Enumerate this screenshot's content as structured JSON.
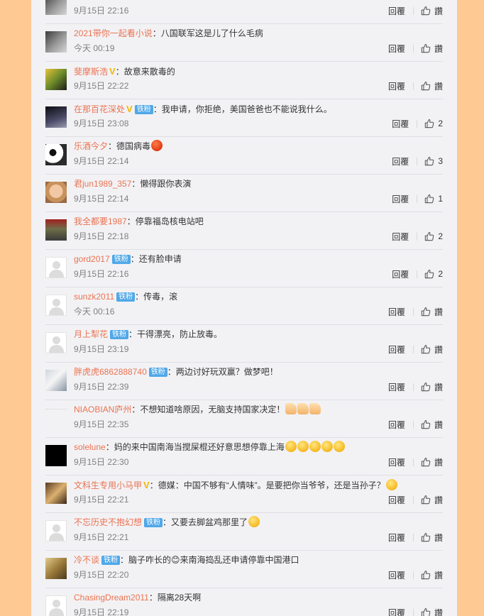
{
  "comments": [
    {
      "avatar": "av-a",
      "name": "",
      "vip": false,
      "fan_badge": "",
      "text": "",
      "emojis": [],
      "time": "9月15日 22:16",
      "reply": "回覆",
      "likes": "讚"
    },
    {
      "avatar": "av-a",
      "name": "2021带你一起看小说",
      "vip": false,
      "fan_badge": "",
      "text": "：八国联军这是儿了什么毛病",
      "emojis": [],
      "time": "今天 00:19",
      "reply": "回覆",
      "likes": "讚"
    },
    {
      "avatar": "av-b",
      "name": "斐摩斯浩",
      "vip": true,
      "fan_badge": "",
      "text": "：故意来散毒的",
      "emojis": [],
      "time": "9月15日 22:22",
      "reply": "回覆",
      "likes": "讚"
    },
    {
      "avatar": "av-c",
      "name": "在那百花深处",
      "vip": true,
      "fan_badge": "铁粉",
      "text": "：我申请，你拒绝，美国爸爸也不能说我什么。",
      "emojis": [],
      "time": "9月15日 23:08",
      "reply": "回覆",
      "likes": "2"
    },
    {
      "avatar": "av-d",
      "name": "乐酒今夕",
      "vip": false,
      "fan_badge": "",
      "text": "：德国病毒",
      "emojis": [
        "red"
      ],
      "time": "9月15日 22:14",
      "reply": "回覆",
      "likes": "3"
    },
    {
      "avatar": "av-e",
      "name": "君jun1989_357",
      "vip": false,
      "fan_badge": "",
      "text": "：懒得跟你表演",
      "emojis": [],
      "time": "9月15日 22:14",
      "reply": "回覆",
      "likes": "1"
    },
    {
      "avatar": "av-f",
      "name": "我全都要1987",
      "vip": false,
      "fan_badge": "",
      "text": "：停靠福岛核电站吧",
      "emojis": [],
      "time": "9月15日 22:18",
      "reply": "回覆",
      "likes": "2"
    },
    {
      "avatar": "default",
      "name": "gord2017",
      "vip": false,
      "fan_badge": "铁粉",
      "text": "：还有脸申请",
      "emojis": [],
      "time": "9月15日 22:16",
      "reply": "回覆",
      "likes": "2"
    },
    {
      "avatar": "default",
      "name": "sunzk2011",
      "vip": false,
      "fan_badge": "铁粉",
      "text": "：传毒，滚",
      "emojis": [],
      "time": "今天 00:16",
      "reply": "回覆",
      "likes": "讚"
    },
    {
      "avatar": "default",
      "name": "月上犁花",
      "vip": false,
      "fan_badge": "铁粉",
      "text": "：干得漂亮，防止放毒。",
      "emojis": [],
      "time": "9月15日 23:19",
      "reply": "回覆",
      "likes": "讚"
    },
    {
      "avatar": "av-h",
      "name": "胖虎虎6862888740",
      "vip": false,
      "fan_badge": "铁粉",
      "text": "：两边讨好玩双赢？做梦吧！",
      "emojis": [],
      "time": "9月15日 22:39",
      "reply": "回覆",
      "likes": "讚"
    },
    {
      "avatar": "blank",
      "name": "NIAOBIAN庐州",
      "vip": false,
      "fan_badge": "",
      "text": "：不想知道啥原因，无脑支持国家决定！",
      "emojis": [
        "thumb",
        "thumb",
        "thumb"
      ],
      "time": "9月15日 22:35",
      "reply": "回覆",
      "likes": "讚"
    },
    {
      "avatar": "black",
      "name": "solelune",
      "vip": false,
      "fan_badge": "",
      "text": "：妈的来中国南海当搅屎棍还好意思想停靠上海",
      "emojis": [
        "yellow",
        "yellow",
        "yellow",
        "yellow",
        "yellow"
      ],
      "time": "9月15日 22:30",
      "reply": "回覆",
      "likes": "讚"
    },
    {
      "avatar": "av-g",
      "name": "文科生专用小马甲",
      "vip": true,
      "fan_badge": "",
      "text": "：德媒：中国不够有“人情味”。是要把你当爷爷，还是当孙子？",
      "emojis": [
        "yellow"
      ],
      "time": "9月15日 22:21",
      "reply": "回覆",
      "likes": "讚"
    },
    {
      "avatar": "default",
      "name": "不忘历史不抱幻想",
      "vip": false,
      "fan_badge": "铁粉",
      "text": "：又要去脚盆鸡那里了",
      "emojis": [
        "yellow"
      ],
      "time": "9月15日 22:21",
      "reply": "回覆",
      "likes": "讚"
    },
    {
      "avatar": "av-i",
      "name": "冷不谈",
      "vip": false,
      "fan_badge": "铁粉",
      "text": "：脑子咋长的😊来南海捣乱还申请停靠中国港口",
      "emojis": [],
      "time": "9月15日 22:20",
      "reply": "回覆",
      "likes": "讚"
    },
    {
      "avatar": "default",
      "name": "ChasingDream2011",
      "vip": false,
      "fan_badge": "",
      "text": "：隔离28天啊",
      "emojis": [],
      "time": "9月15日 22:19",
      "reply": "回覆",
      "likes": "讚"
    }
  ],
  "icons": {
    "like": "thumbs-up-icon",
    "vip": "vip-v-icon"
  },
  "colors": {
    "page_bg": "#ffc993",
    "panel_bg": "#f2f2f5",
    "username": "#eb7350",
    "badge": "#4fa8e8",
    "vip": "#f7b500"
  }
}
